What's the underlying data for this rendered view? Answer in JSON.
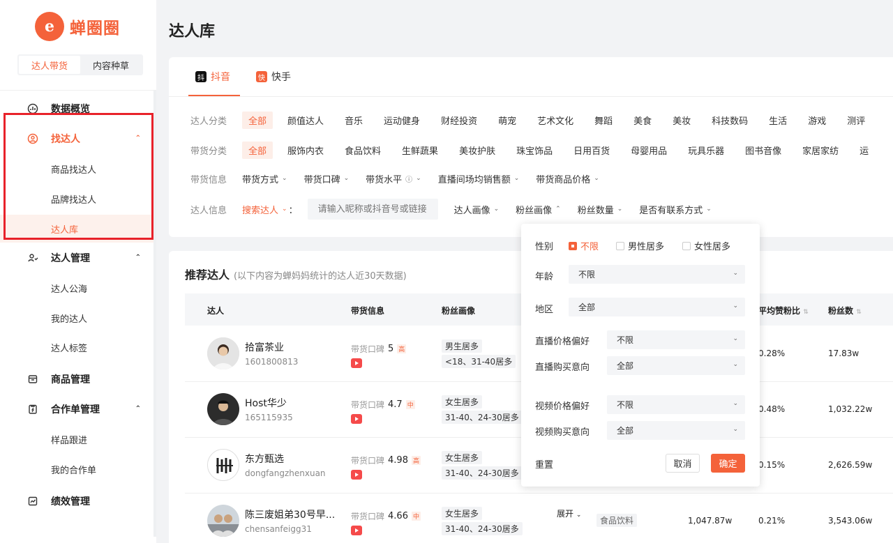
{
  "brand": {
    "name": "蝉圈圈",
    "logo_glyph": "e",
    "color": "#f4623a"
  },
  "mode_switch": {
    "active": "达人带货",
    "other": "内容种草"
  },
  "nav": {
    "overview": "数据概览",
    "find": "找达人",
    "find_sub": [
      "商品找达人",
      "品牌找达人",
      "达人库"
    ],
    "manage": "达人管理",
    "manage_sub": [
      "达人公海",
      "我的达人",
      "达人标签"
    ],
    "product": "商品管理",
    "orders": "合作单管理",
    "orders_sub": [
      "样品跟进",
      "我的合作单"
    ],
    "performance": "绩效管理"
  },
  "page_title": "达人库",
  "platforms": [
    {
      "label": "抖音",
      "glyph": "抖",
      "color": "#111111"
    },
    {
      "label": "快手",
      "glyph": "快",
      "color": "#f4623a"
    }
  ],
  "filters": {
    "category": {
      "label": "达人分类",
      "items": [
        "全部",
        "颜值达人",
        "音乐",
        "运动健身",
        "财经投资",
        "萌宠",
        "艺术文化",
        "舞蹈",
        "美食",
        "美妆",
        "科技数码",
        "生活",
        "游戏",
        "测评"
      ]
    },
    "goods": {
      "label": "带货分类",
      "items": [
        "全部",
        "服饰内衣",
        "食品饮料",
        "生鲜蔬果",
        "美妆护肤",
        "珠宝饰品",
        "日用百货",
        "母婴用品",
        "玩具乐器",
        "图书音像",
        "家居家纺",
        "运"
      ]
    },
    "sales": {
      "label": "带货信息",
      "dropdowns": [
        "带货方式",
        "带货口碑",
        "带货水平",
        "直播间场均销售额",
        "带货商品价格"
      ]
    },
    "info": {
      "label": "达人信息",
      "search_label": "搜索达人",
      "search_colon": "：",
      "placeholder": "请输入昵称或抖音号或链接",
      "dropdowns": [
        "达人画像",
        "粉丝画像",
        "粉丝数量",
        "是否有联系方式"
      ]
    }
  },
  "recommend": {
    "title": "推荐达人",
    "subtitle": "(以下内容为蝉妈妈统计的达人近30天数据)",
    "columns": {
      "kol": "达人",
      "sales": "带货信息",
      "fans_portrait": "粉丝画像",
      "avg_like_ratio": "平均赞粉比",
      "fans": "粉丝数"
    },
    "rows": [
      {
        "name": "拾富茶业",
        "id": "1601800813",
        "rep_label": "带货口碑",
        "score": "5",
        "level": "高",
        "gender": "男生居多",
        "age": "<18、31-40居多",
        "ratio": "0.28%",
        "fans": "17.83w"
      },
      {
        "name": "Host华少",
        "id": "165115935",
        "rep_label": "带货口碑",
        "score": "4.7",
        "level": "中",
        "gender": "女生居多",
        "age": "31-40、24-30居多",
        "ratio": "0.48%",
        "fans": "1,032.22w"
      },
      {
        "name": "东方甄选",
        "id": "dongfangzhenxuan",
        "rep_label": "带货口碑",
        "score": "4.98",
        "level": "高",
        "gender": "女生居多",
        "age": "31-40、24-30居多",
        "ratio": "0.15%",
        "fans": "2,626.59w"
      },
      {
        "name": "陈三废姐弟30号早...",
        "id": "chensanfeigg31",
        "rep_label": "带货口碑",
        "score": "4.66",
        "level": "中",
        "gender": "女生居多",
        "age": "31-40、24-30居多",
        "expand": "展开",
        "category": "食品饮料",
        "avg_sales": "1,047.87w",
        "ratio": "0.21%",
        "fans": "3,543.06w"
      }
    ]
  },
  "popover": {
    "gender_label": "性别",
    "gender_options": [
      "不限",
      "男性居多",
      "女性居多"
    ],
    "age_label": "年龄",
    "age_value": "不限",
    "region_label": "地区",
    "region_value": "全部",
    "live_price_label": "直播价格偏好",
    "live_price_value": "不限",
    "live_intent_label": "直播购买意向",
    "live_intent_value": "全部",
    "video_price_label": "视频价格偏好",
    "video_price_value": "不限",
    "video_intent_label": "视频购买意向",
    "video_intent_value": "全部",
    "reset": "重置",
    "cancel": "取消",
    "confirm": "确定"
  }
}
